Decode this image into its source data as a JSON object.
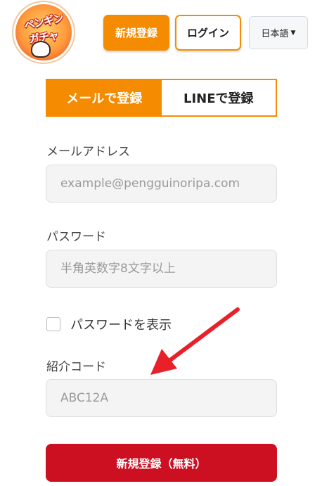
{
  "logo": {
    "line1": "ペンギン",
    "line2": "ガチャ"
  },
  "header": {
    "signup_label": "新規登録",
    "login_label": "ログイン",
    "language": "日本語",
    "language_caret": "▼"
  },
  "tabs": [
    {
      "label": "メールで登録",
      "active": true
    },
    {
      "label": "LINEで登録",
      "active": false
    }
  ],
  "form": {
    "email": {
      "label": "メールアドレス",
      "placeholder": "example@pengguinoripa.com",
      "value": ""
    },
    "password": {
      "label": "パスワード",
      "placeholder": "半角英数字8文字以上",
      "value": ""
    },
    "show_password": {
      "label": "パスワードを表示",
      "checked": false
    },
    "referral": {
      "label": "紹介コード",
      "placeholder": "ABC12A",
      "value": ""
    },
    "submit_label": "新規登録（無料）"
  },
  "colors": {
    "accent": "#f58b00",
    "submit": "#cc1022",
    "annotation_arrow": "#e8202a"
  }
}
